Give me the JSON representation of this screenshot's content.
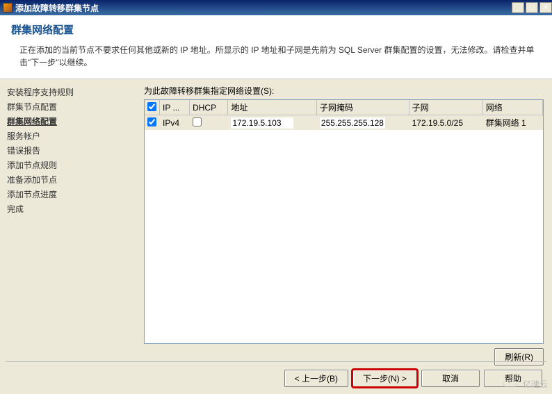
{
  "window": {
    "title": "添加故障转移群集节点"
  },
  "header": {
    "title": "群集网络配置",
    "desc": "正在添加的当前节点不要求任何其他或新的 IP 地址。所显示的 IP 地址和子网是先前为 SQL Server 群集配置的设置，无法修改。请检查并单击\"下一步\"以继续。"
  },
  "sidebar": {
    "items": [
      "安装程序支持规则",
      "群集节点配置",
      "群集网络配置",
      "服务帐户",
      "错误报告",
      "添加节点规则",
      "准备添加节点",
      "添加节点进度",
      "完成"
    ],
    "active_index": 2
  },
  "main": {
    "label": "为此故障转移群集指定网络设置(S):",
    "columns": {
      "check": "",
      "ip": "IP ...",
      "dhcp": "DHCP",
      "addr": "地址",
      "mask": "子网掩码",
      "subnet": "子网",
      "network": "网络"
    },
    "row": {
      "checked": true,
      "ip": "IPv4",
      "dhcp": false,
      "addr": "172.19.5.103",
      "mask": "255.255.255.128",
      "subnet": "172.19.5.0/25",
      "network": "群集网络 1"
    },
    "refresh": "刷新(R)"
  },
  "footer": {
    "back": "< 上一步(B)",
    "next": "下一步(N) >",
    "cancel": "取消",
    "help": "帮助"
  },
  "watermark": "亿速云"
}
